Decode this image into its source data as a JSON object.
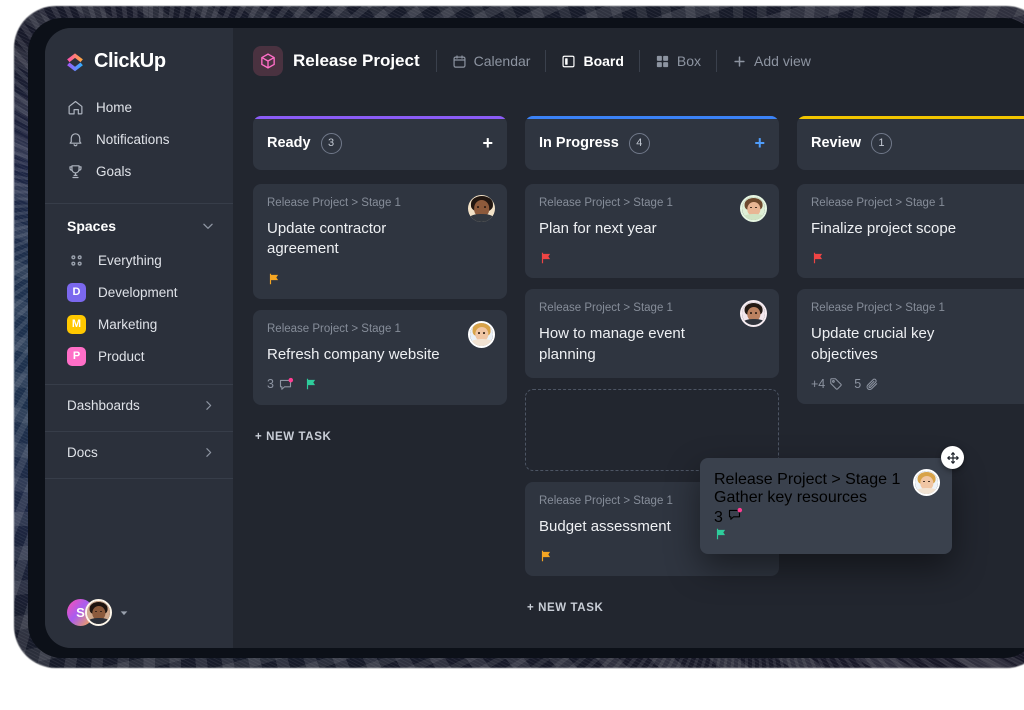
{
  "app": {
    "logo_text": "ClickUp"
  },
  "sidebar": {
    "nav": [
      {
        "label": "Home",
        "icon": "home-icon"
      },
      {
        "label": "Notifications",
        "icon": "bell-icon"
      },
      {
        "label": "Goals",
        "icon": "trophy-icon"
      }
    ],
    "spaces_heading": "Spaces",
    "spaces": [
      {
        "label": "Everything",
        "badge": "",
        "color": "",
        "icon": "grid-icon"
      },
      {
        "label": "Development",
        "badge": "D",
        "color": "#7b68ee"
      },
      {
        "label": "Marketing",
        "badge": "M",
        "color": "#ffc800"
      },
      {
        "label": "Product",
        "badge": "P",
        "color": "#ff6ec7"
      }
    ],
    "footer_items": [
      {
        "label": "Dashboards"
      },
      {
        "label": "Docs"
      }
    ],
    "workspace_initial": "S"
  },
  "header": {
    "project_title": "Release Project",
    "views": [
      {
        "label": "Calendar",
        "icon": "calendar-icon",
        "active": false
      },
      {
        "label": "Board",
        "icon": "board-icon",
        "active": true
      },
      {
        "label": "Box",
        "icon": "box-grid-icon",
        "active": false
      }
    ],
    "add_view_label": "Add view"
  },
  "board": {
    "new_task_label": "+ NEW TASK",
    "columns": [
      {
        "name": "Ready",
        "count": "3",
        "accent": "#8b5cf6",
        "add_color": "#ffffff",
        "cards": [
          {
            "crumb": "Release Project > Stage 1",
            "title": "Update contractor agreement",
            "flag": "#f5a623",
            "avatar": "avatar-dark-beard",
            "comments": "",
            "tags": "",
            "attachments": ""
          },
          {
            "crumb": "Release Project > Stage 1",
            "title": "Refresh company website",
            "flag": "#2ecc9b",
            "avatar": "avatar-blonde",
            "comments": "3",
            "tags": "",
            "attachments": ""
          }
        ]
      },
      {
        "name": "In Progress",
        "count": "4",
        "accent": "#3b82f6",
        "add_color": "#4f9dfb",
        "cards": [
          {
            "crumb": "Release Project > Stage 1",
            "title": "Plan for next year",
            "flag": "#ef4444",
            "avatar": "avatar-woman-green",
            "comments": "",
            "tags": "",
            "attachments": ""
          },
          {
            "crumb": "Release Project > Stage 1",
            "title": "How to manage event planning",
            "flag": "",
            "avatar": "avatar-man-light",
            "comments": "",
            "tags": "",
            "attachments": ""
          },
          {
            "crumb": "Release Project > Stage 1",
            "title": "Budget assessment",
            "flag": "#f5a623",
            "avatar": "",
            "comments": "",
            "tags": "",
            "attachments": ""
          }
        ]
      },
      {
        "name": "Review",
        "count": "1",
        "accent": "#f2c500",
        "add_color": "#ffffff",
        "cards": [
          {
            "crumb": "Release Project > Stage 1",
            "title": "Finalize project scope",
            "flag": "#ef4444",
            "avatar": "",
            "comments": "",
            "tags": "",
            "attachments": ""
          },
          {
            "crumb": "Release Project > Stage 1",
            "title": "Update crucial key objectives",
            "flag": "",
            "avatar": "",
            "comments": "",
            "tags": "+4",
            "attachments": "5"
          }
        ]
      }
    ]
  },
  "drag": {
    "crumb": "Release Project > Stage 1",
    "title": "Gather key resources",
    "comments": "3",
    "flag": "#2ecc9b"
  }
}
